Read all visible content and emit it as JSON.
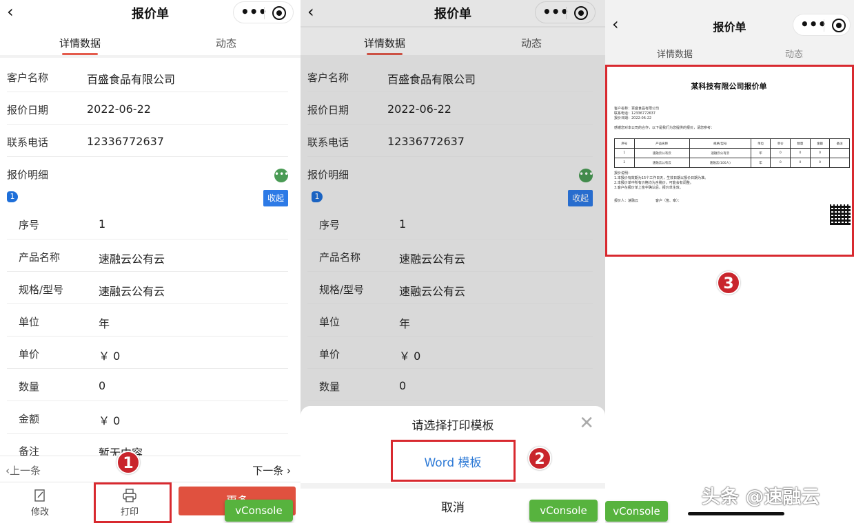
{
  "panel1": {
    "title": "报价单",
    "tabs": [
      "详情数据",
      "动态"
    ],
    "fields": [
      {
        "label": "客户名称",
        "value": "百盛食品有限公司"
      },
      {
        "label": "报价日期",
        "value": "2022-06-22"
      },
      {
        "label": "联系电话",
        "value": "12336772637"
      }
    ],
    "section_label": "报价明细",
    "item_index": "1",
    "fold_label": "收起",
    "items": [
      {
        "label": "序号",
        "value": "1"
      },
      {
        "label": "产品名称",
        "value": "速融云公有云"
      },
      {
        "label": "规格/型号",
        "value": "速融云公有云"
      },
      {
        "label": "单位",
        "value": "年"
      },
      {
        "label": "单价",
        "value": "￥ 0"
      },
      {
        "label": "数量",
        "value": "0"
      },
      {
        "label": "金额",
        "value": "￥ 0"
      },
      {
        "label": "备注",
        "value": "暂无内容"
      }
    ],
    "prev_label": "上一条",
    "next_label": "下一条",
    "edit_label": "修改",
    "print_label": "打印",
    "more_label": "更多",
    "vconsole_label": "vConsole",
    "step_number": "1"
  },
  "panel2": {
    "title": "报价单",
    "tabs": [
      "详情数据",
      "动态"
    ],
    "fields": [
      {
        "label": "客户名称",
        "value": "百盛食品有限公司"
      },
      {
        "label": "报价日期",
        "value": "2022-06-22"
      },
      {
        "label": "联系电话",
        "value": "12336772637"
      }
    ],
    "section_label": "报价明细",
    "item_index": "1",
    "fold_label": "收起",
    "items": [
      {
        "label": "序号",
        "value": "1"
      },
      {
        "label": "产品名称",
        "value": "速融云公有云"
      },
      {
        "label": "规格/型号",
        "value": "速融云公有云"
      },
      {
        "label": "单位",
        "value": "年"
      },
      {
        "label": "单价",
        "value": "￥ 0"
      },
      {
        "label": "数量",
        "value": "0"
      }
    ],
    "sheet": {
      "title": "请选择打印模板",
      "option": "Word 模板",
      "cancel": "取消"
    },
    "vconsole_label": "vConsole",
    "step_number": "2"
  },
  "panel3": {
    "title": "报价单",
    "tabs": [
      "详情数据",
      "动态"
    ],
    "doc": {
      "title": "某科技有限公司报价单",
      "meta_lines": [
        "客户名称：百盛食品有限公司",
        "联系电话：12336772637",
        "报价日期：2022-06-22"
      ],
      "intro": "感谢您对本公司的合作，以下是我们为您提供的报价，请您参考：",
      "table_header": [
        "序号",
        "产品名称",
        "规格/型号",
        "单位",
        "单价",
        "数量",
        "金额",
        "备注"
      ],
      "table_rows": [
        [
          "1",
          "速融云公有云",
          "速融云公有云",
          "年",
          "0",
          "0",
          "0",
          ""
        ],
        [
          "2",
          "速融云公有云",
          "速融云(100人)",
          "年",
          "0",
          "0",
          "0",
          ""
        ]
      ],
      "notes_title": "报价说明：",
      "notes": [
        "1.本报价有效期为15个工作日天，生效日期以报价日期为准。",
        "2.本报价单中所有价格均为含税价，可能会有调整。",
        "3.客户在报价单上签字确认后，报价单生效。"
      ],
      "signature_left": "报价人：速融云",
      "signature_right": "客户（签、章）："
    },
    "vconsole_label": "vConsole",
    "step_number": "3",
    "watermark": "头条 @速融云"
  }
}
